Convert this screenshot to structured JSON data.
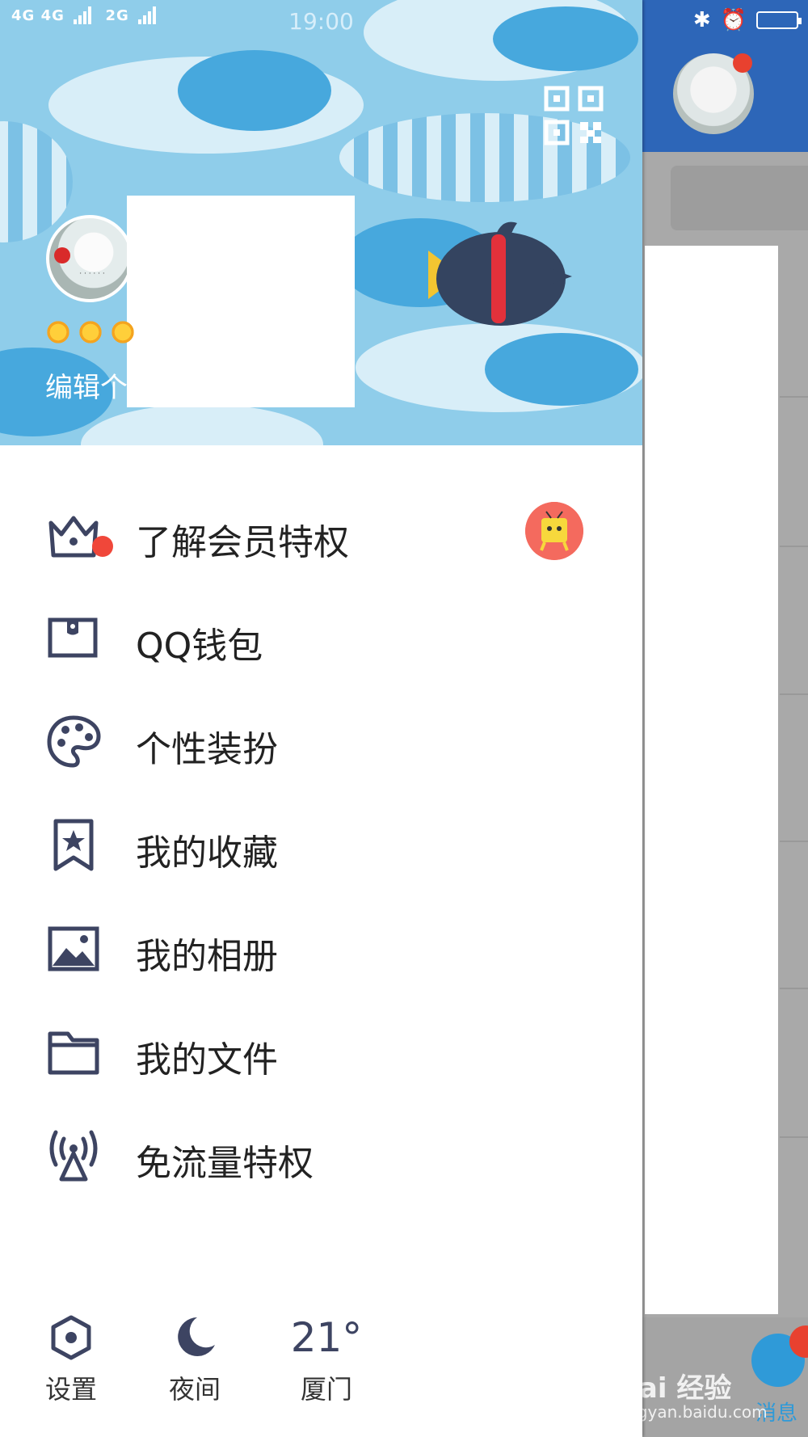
{
  "status_bar": {
    "network_left": "4G 4G",
    "network_right": "2G",
    "time": "19:00"
  },
  "profile": {
    "edit_label": "编辑个",
    "level_icons": [
      "sun-icon",
      "sun-icon",
      "sun-icon"
    ]
  },
  "menu": {
    "items": [
      {
        "label": "了解会员特权",
        "icon": "crown-icon"
      },
      {
        "label": "QQ钱包",
        "icon": "wallet-icon"
      },
      {
        "label": "个性装扮",
        "icon": "palette-icon"
      },
      {
        "label": "我的收藏",
        "icon": "bookmark-star-icon"
      },
      {
        "label": "我的相册",
        "icon": "photo-album-icon"
      },
      {
        "label": "我的文件",
        "icon": "folder-icon"
      },
      {
        "label": "免流量特权",
        "icon": "antenna-icon"
      }
    ]
  },
  "bottom_bar": {
    "settings_label": "设置",
    "night_label": "夜间",
    "weather_temp": "21°",
    "weather_city": "厦门"
  },
  "background_app": {
    "tab_label": "消息",
    "watermark": "Bai 经验",
    "watermark_url": "jingyan.baidu.com"
  },
  "colors": {
    "header_bg": "#8fcdea",
    "icon_color": "#3d4462",
    "notification_red": "#f0473a",
    "background_header": "#2d66b8"
  }
}
